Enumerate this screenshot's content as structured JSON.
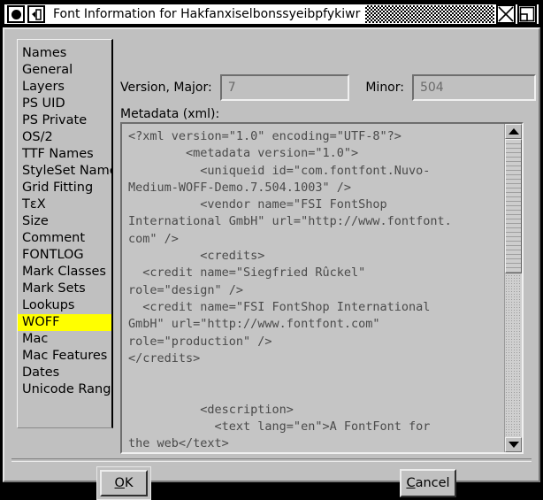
{
  "window": {
    "title": "Font Information for Hakfanxiselbonssyeibpfykiwr",
    "icons": {
      "app": "app-circle-icon",
      "shade": "window-shade-icon",
      "close": "close-icon",
      "maximize": "maximize-icon"
    }
  },
  "sidebar": {
    "items": [
      {
        "label": "Names",
        "selected": false
      },
      {
        "label": "General",
        "selected": false
      },
      {
        "label": "Layers",
        "selected": false
      },
      {
        "label": "PS UID",
        "selected": false
      },
      {
        "label": "PS Private",
        "selected": false
      },
      {
        "label": "OS/2",
        "selected": false
      },
      {
        "label": "TTF Names",
        "selected": false
      },
      {
        "label": "StyleSet Names",
        "selected": false
      },
      {
        "label": "Grid Fitting",
        "selected": false
      },
      {
        "label": "TεX",
        "selected": false
      },
      {
        "label": "Size",
        "selected": false
      },
      {
        "label": "Comment",
        "selected": false
      },
      {
        "label": "FONTLOG",
        "selected": false
      },
      {
        "label": "Mark Classes",
        "selected": false
      },
      {
        "label": "Mark Sets",
        "selected": false
      },
      {
        "label": "Lookups",
        "selected": false
      },
      {
        "label": "WOFF",
        "selected": true
      },
      {
        "label": "Mac",
        "selected": false
      },
      {
        "label": "Mac Features",
        "selected": false
      },
      {
        "label": "Dates",
        "selected": false
      },
      {
        "label": "Unicode Ranges",
        "selected": false
      }
    ],
    "selection_color": "#ffff00"
  },
  "form": {
    "major_label": "Version, Major:",
    "major_value": "7",
    "minor_label": "Minor:",
    "minor_value": "504",
    "metadata_label": "Metadata (xml):",
    "metadata_value": "<?xml version=\"1.0\" encoding=\"UTF-8\"?>\n        <metadata version=\"1.0\">\n          <uniqueid id=\"com.fontfont.Nuvo-\nMedium-WOFF-Demo.7.504.1003\" />\n          <vendor name=\"FSI FontShop\nInternational GmbH\" url=\"http://www.fontfont.\ncom\" />\n          <credits>\n  <credit name=\"Siegfried Rûckel\"\nrole=\"design\" />\n  <credit name=\"FSI FontShop International\nGmbH\" url=\"http://www.fontfont.com\"\nrole=\"production\" />\n</credits>\n\n\n          <description>\n            <text lang=\"en\">A FontFont for\nthe web</text>\n          </description>"
  },
  "scrollbar": {
    "up_icon": "scroll-up-arrow-icon",
    "down_icon": "scroll-down-arrow-icon",
    "thumb_position_percent": 0,
    "thumb_size_percent": 45
  },
  "buttons": {
    "ok": "OK",
    "ok_mnemonic": "O",
    "cancel": "Cancel",
    "cancel_mnemonic": "C"
  },
  "colors": {
    "face": "#c0c0c0",
    "highlight": "#ffff00",
    "text": "#000000",
    "disabled_text": "#6a6a6a"
  }
}
